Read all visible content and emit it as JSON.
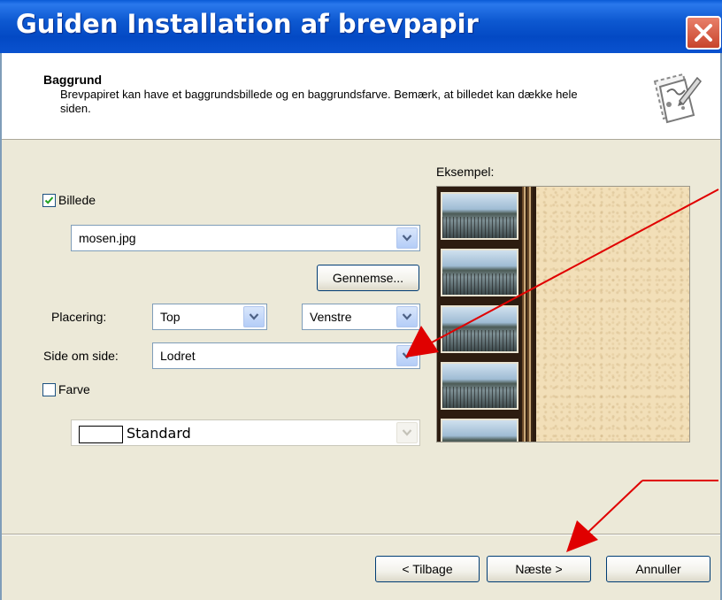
{
  "window": {
    "title": "Guiden Installation af brevpapir",
    "close_icon": "close-icon"
  },
  "header": {
    "title": "Baggrund",
    "description": "Brevpapiret kan have et baggrundsbillede og en baggrundsfarve. Bemærk, at billedet kan dække hele siden.",
    "icon": "stationery-wizard-icon"
  },
  "form": {
    "picture": {
      "label": "Billede",
      "checked": true
    },
    "picture_file": {
      "value": "mosen.jpg"
    },
    "browse_label": "Gennemse...",
    "position": {
      "label": "Placering:",
      "vertical": "Top",
      "horizontal": "Venstre"
    },
    "tile": {
      "label": "Side om side:",
      "value": "Lodret"
    },
    "color": {
      "label": "Farve",
      "checked": false,
      "value": "Standard"
    }
  },
  "preview": {
    "label": "Eksempel:"
  },
  "footer": {
    "back_label": "< Tilbage",
    "next_label": "Næste >",
    "cancel_label": "Annuller"
  },
  "colors": {
    "titlebar": "#0349c4",
    "dialog_bg": "#ece9d8",
    "annotation_arrow": "#e00000"
  }
}
